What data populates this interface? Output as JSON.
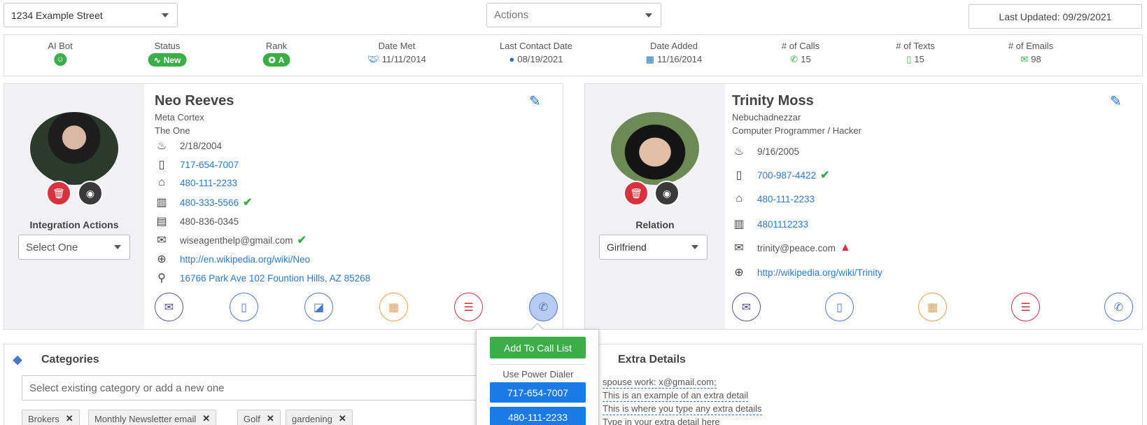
{
  "toolbar": {
    "address_select": "1234 Example Street",
    "actions_placeholder": "Actions",
    "last_updated": "Last Updated: 09/29/2021"
  },
  "stats": {
    "ai_bot": {
      "label": "AI Bot"
    },
    "status": {
      "label": "Status",
      "value": "New"
    },
    "rank": {
      "label": "Rank",
      "value": "A"
    },
    "date_met": {
      "label": "Date Met",
      "value": "11/11/2014"
    },
    "last_contact": {
      "label": "Last Contact Date",
      "value": "08/19/2021"
    },
    "date_added": {
      "label": "Date Added",
      "value": "11/16/2014"
    },
    "calls": {
      "label": "# of Calls",
      "value": "15"
    },
    "texts": {
      "label": "# of Texts",
      "value": "15"
    },
    "emails": {
      "label": "# of Emails",
      "value": "98"
    }
  },
  "primary": {
    "name": "Neo Reeves",
    "company": "Meta Cortex",
    "title": "The One",
    "birthday": "2/18/2004",
    "mobile": "717-654-7007",
    "home": "480-111-2233",
    "office": "480-333-5566",
    "fax": "480-836-0345",
    "email": "wiseagenthelp@gmail.com",
    "website": "http://en.wikipedia.org/wiki/Neo",
    "address": "16766 Park Ave 102 Fountion Hills, AZ 85268",
    "side_label": "Integration Actions",
    "side_select": "Select One"
  },
  "spouse": {
    "name": "Trinity Moss",
    "company": "Nebuchadnezzar",
    "title": "Computer Programmer / Hacker",
    "birthday": "9/16/2005",
    "mobile": "700-987-4422",
    "home": "480-111-2233",
    "office": "4801112233",
    "email": "trinity@peace.com",
    "website": "http://wikipedia.org/wiki/Trinity",
    "side_label": "Relation",
    "side_select": "Girlfriend"
  },
  "categories": {
    "title": "Categories",
    "input_placeholder": "Select existing category or add a new one",
    "tags": [
      "Brokers",
      "Monthly Newsletter email",
      "Golf",
      "gardening"
    ]
  },
  "extra": {
    "title": "Extra Details",
    "lines": [
      "spouse work: x@gmail.com;",
      "This is an example of an extra detail",
      "This is where you type any extra details",
      "Type in your extra detail here"
    ]
  },
  "popover": {
    "add_to_call_list": "Add To Call List",
    "power_dialer_label": "Use Power Dialer",
    "numbers": [
      "717-654-7007",
      "480-111-2233"
    ]
  },
  "colors": {
    "accent_green": "#3cae48",
    "link_blue": "#2a7ac9",
    "danger_red": "#d9313d",
    "dialer_blue": "#1a7ae6"
  }
}
